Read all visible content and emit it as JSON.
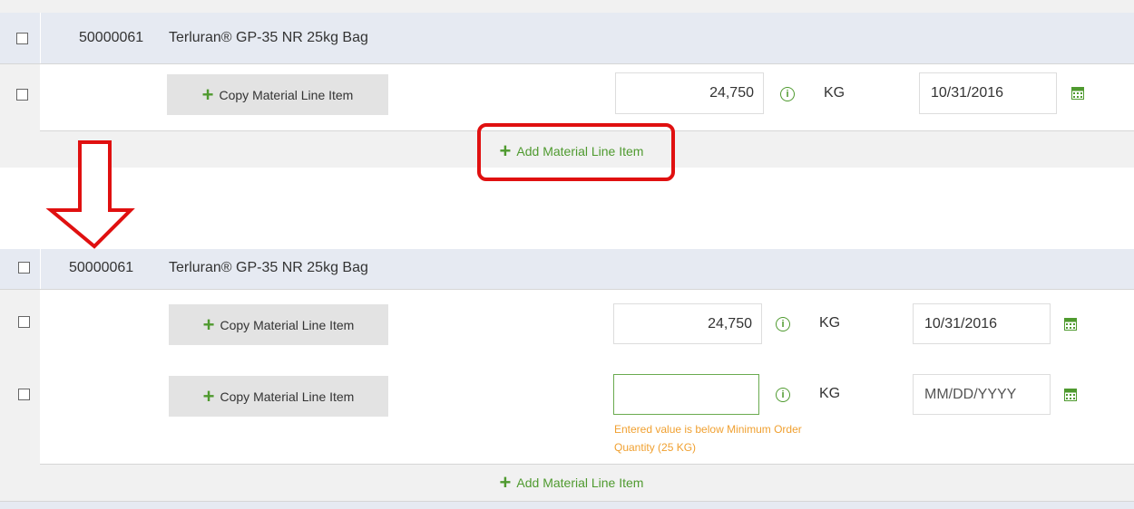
{
  "before": {
    "header": {
      "material_id": "50000061",
      "description": "Terluran® GP-35 NR 25kg Bag"
    },
    "line_items": [
      {
        "copy_label": "Copy Material Line Item",
        "quantity": "24,750",
        "info": "i",
        "unit": "KG",
        "date": "10/31/2016"
      }
    ],
    "add_label": "Add Material Line Item"
  },
  "after": {
    "header": {
      "material_id": "50000061",
      "description": "Terluran® GP-35 NR 25kg Bag"
    },
    "line_items": [
      {
        "copy_label": "Copy Material Line Item",
        "quantity": "24,750",
        "info": "i",
        "unit": "KG",
        "date": "10/31/2016"
      },
      {
        "copy_label": "Copy Material Line Item",
        "quantity": "",
        "info": "i",
        "unit": "KG",
        "date_placeholder": "MM/DD/YYYY",
        "error": "Entered value is below Minimum Order Quantity (25 KG)"
      }
    ],
    "add_label": "Add Material Line Item"
  },
  "icons": {
    "plus": "+",
    "calendar": "calendar-icon",
    "info": "info-icon",
    "arrow": "down-arrow-icon"
  },
  "colors": {
    "accent_green": "#4f9a2f",
    "highlight_red": "#e01010",
    "error_orange": "#f0a030",
    "header_bg": "#e6eaf2"
  }
}
